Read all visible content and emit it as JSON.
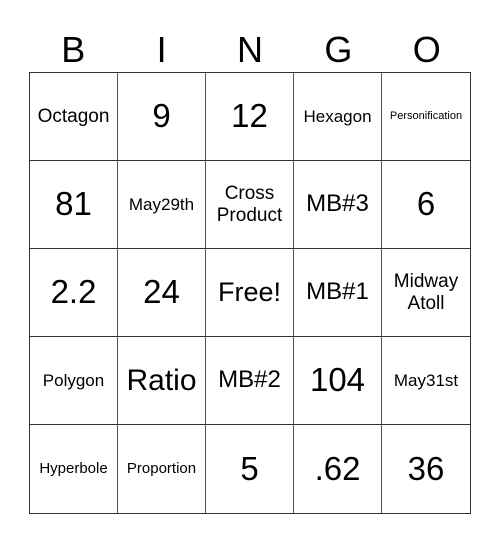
{
  "header": [
    "B",
    "I",
    "N",
    "G",
    "O"
  ],
  "rows": [
    [
      "Octagon",
      "9",
      "12",
      "Hexagon",
      "Personification"
    ],
    [
      "81",
      "May29th",
      "Cross Product",
      "MB#3",
      "6"
    ],
    [
      "2.2",
      "24",
      "Free!",
      "MB#1",
      "Midway Atoll"
    ],
    [
      "Polygon",
      "Ratio",
      "MB#2",
      "104",
      "May31st"
    ],
    [
      "Hyperbole",
      "Proportion",
      "5",
      ".62",
      "36"
    ]
  ]
}
